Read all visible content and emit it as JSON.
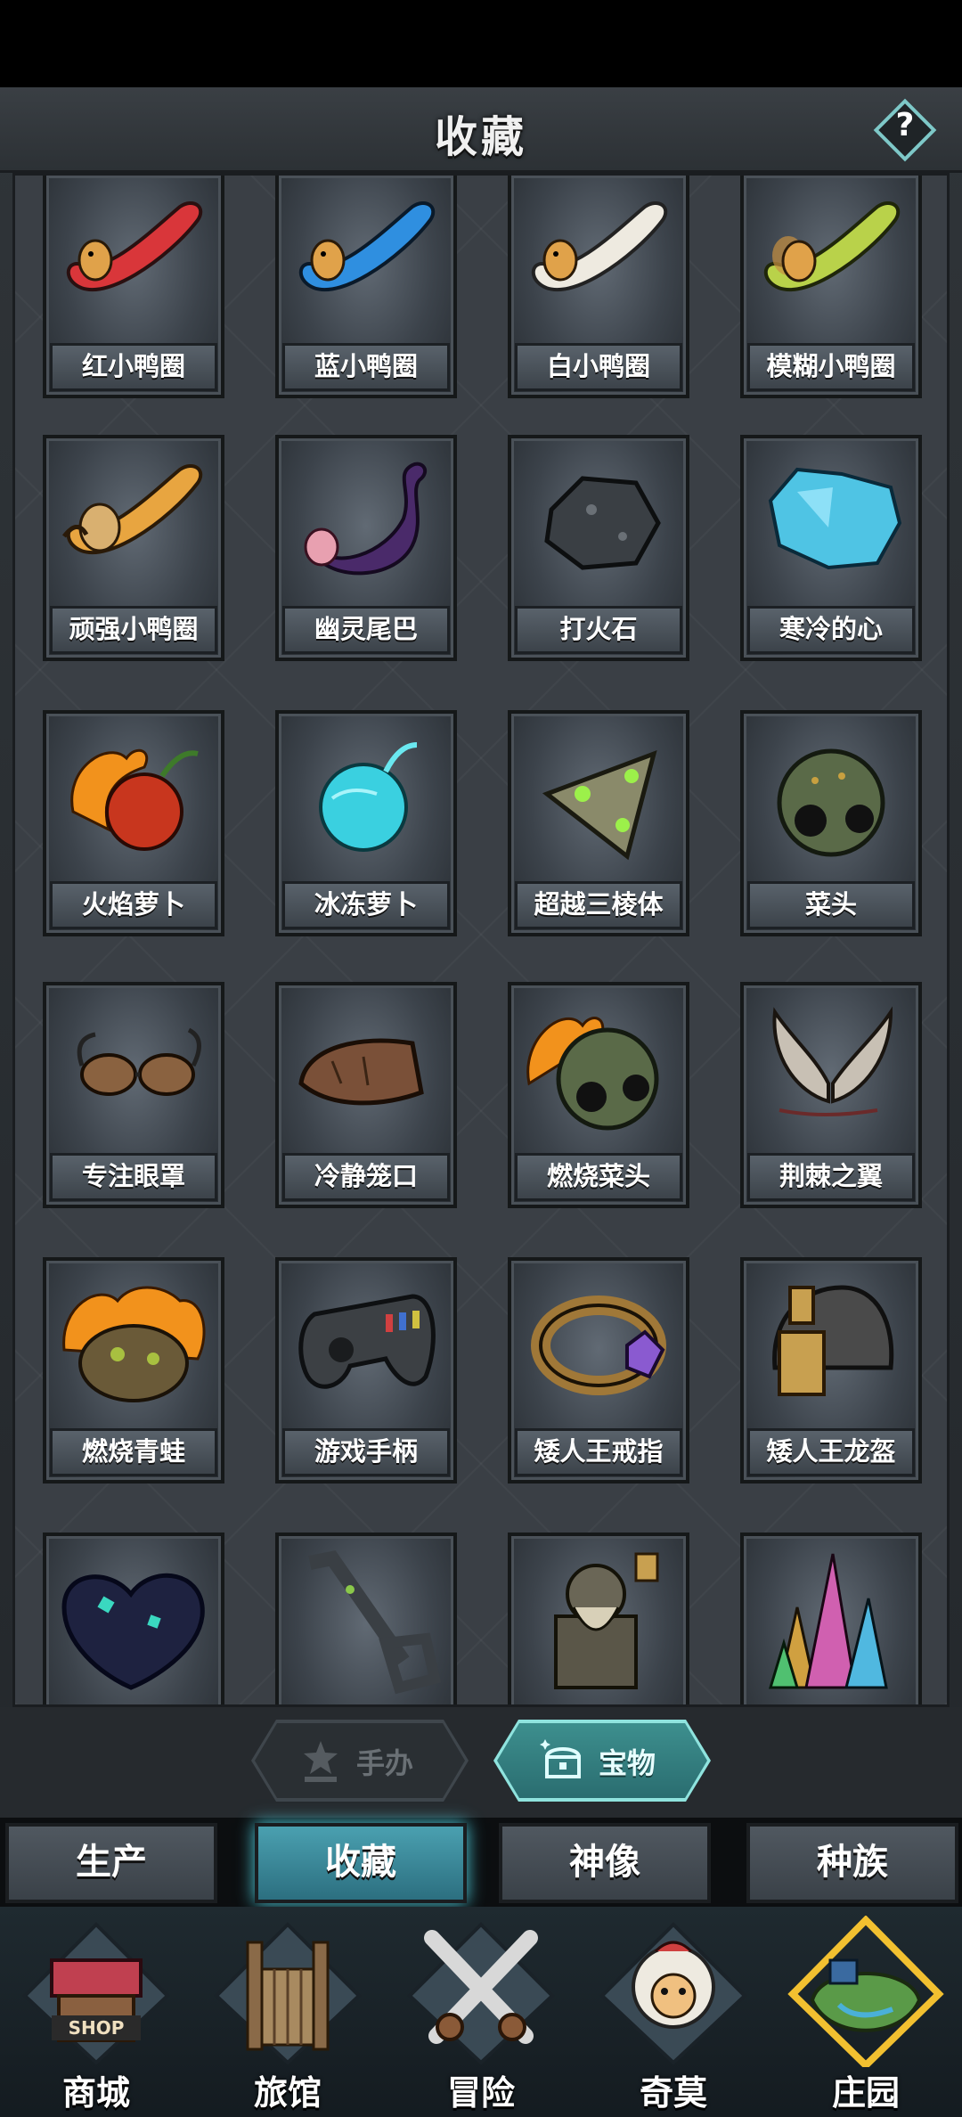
{
  "header": {
    "title": "收藏",
    "help_label": "?"
  },
  "items": [
    {
      "label": "红小鸭圈",
      "icon": "red-duck-ring-icon"
    },
    {
      "label": "蓝小鸭圈",
      "icon": "blue-duck-ring-icon"
    },
    {
      "label": "白小鸭圈",
      "icon": "white-duck-ring-icon"
    },
    {
      "label": "模糊小鸭圈",
      "icon": "blurry-duck-ring-icon"
    },
    {
      "label": "顽强小鸭圈",
      "icon": "tough-duck-ring-icon"
    },
    {
      "label": "幽灵尾巴",
      "icon": "ghost-tail-icon"
    },
    {
      "label": "打火石",
      "icon": "flint-icon"
    },
    {
      "label": "寒冷的心",
      "icon": "cold-heart-icon"
    },
    {
      "label": "火焰萝卜",
      "icon": "flame-radish-icon"
    },
    {
      "label": "冰冻萝卜",
      "icon": "frozen-radish-icon"
    },
    {
      "label": "超越三棱体",
      "icon": "transcendent-prism-icon"
    },
    {
      "label": "菜头",
      "icon": "vegetable-head-icon"
    },
    {
      "label": "专注眼罩",
      "icon": "focus-blindfold-icon"
    },
    {
      "label": "冷静笼口",
      "icon": "calm-muzzle-icon"
    },
    {
      "label": "燃烧菜头",
      "icon": "burning-vegetable-head-icon"
    },
    {
      "label": "荆棘之翼",
      "icon": "thorn-wings-icon"
    },
    {
      "label": "燃烧青蛙",
      "icon": "burning-frog-icon"
    },
    {
      "label": "游戏手柄",
      "icon": "gamepad-icon"
    },
    {
      "label": "矮人王戒指",
      "icon": "dwarf-king-ring-icon"
    },
    {
      "label": "矮人王龙盔",
      "icon": "dwarf-king-dragon-helmet-icon"
    },
    {
      "label": "",
      "icon": "dark-gem-heart-icon"
    },
    {
      "label": "",
      "icon": "ancient-key-icon"
    },
    {
      "label": "",
      "icon": "dwarf-king-statue-icon"
    },
    {
      "label": "",
      "icon": "rainbow-crystal-icon"
    }
  ],
  "sub_tabs": [
    {
      "label": "手办",
      "icon": "figure-icon",
      "state": "disabled"
    },
    {
      "label": "宝物",
      "icon": "treasure-chest-icon",
      "state": "active"
    }
  ],
  "category_tabs": [
    {
      "label": "生产",
      "active": false
    },
    {
      "label": "收藏",
      "active": true
    },
    {
      "label": "神像",
      "active": false
    },
    {
      "label": "种族",
      "active": false
    }
  ],
  "bottom_nav": [
    {
      "label": "商城",
      "icon": "shop-icon",
      "badge_text": "SHOP"
    },
    {
      "label": "旅馆",
      "icon": "inn-icon"
    },
    {
      "label": "冒险",
      "icon": "crossed-swords-icon"
    },
    {
      "label": "奇莫",
      "icon": "qimo-creature-icon"
    },
    {
      "label": "庄园",
      "icon": "manor-island-icon"
    }
  ],
  "colors": {
    "accent": "#4fb8bc",
    "panel": "#2f3438",
    "card": "#4a525a"
  }
}
